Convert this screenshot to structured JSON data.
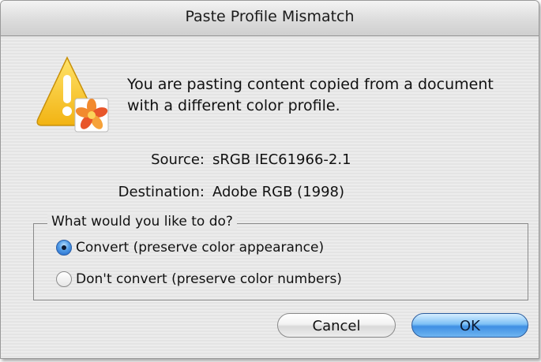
{
  "dialog": {
    "title": "Paste Profile Mismatch",
    "message": "You are pasting content copied from a document with a different color profile.",
    "icon": "warning-triangle-icon"
  },
  "profiles": {
    "source_label": "Source:",
    "source_value": "sRGB IEC61966-2.1",
    "destination_label": "Destination:",
    "destination_value": "Adobe RGB (1998)"
  },
  "options": {
    "legend": "What would you like to do?",
    "items": [
      {
        "label": "Convert (preserve color appearance)",
        "selected": true
      },
      {
        "label": "Don't convert (preserve color numbers)",
        "selected": false
      }
    ]
  },
  "buttons": {
    "cancel_label": "Cancel",
    "ok_label": "OK"
  },
  "colors": {
    "accent": "#3f8fe3",
    "warning": "#f4c21a"
  }
}
